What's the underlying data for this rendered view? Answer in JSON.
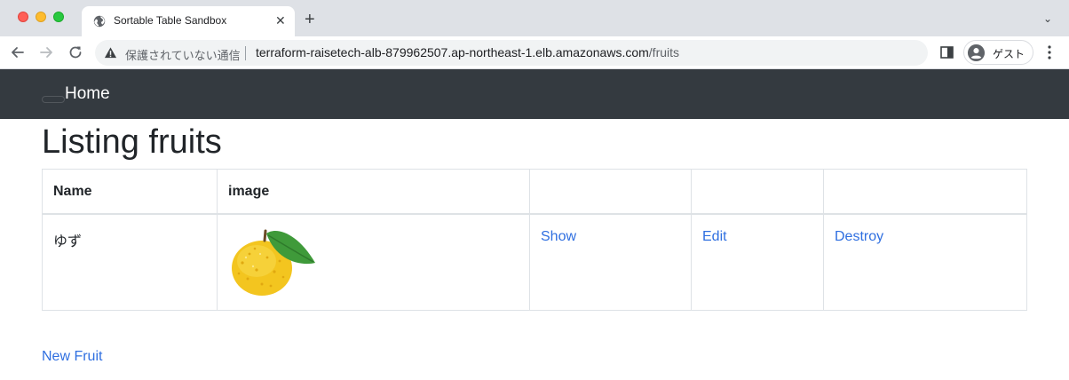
{
  "browser": {
    "tab_title": "Sortable Table Sandbox",
    "close_glyph": "✕",
    "new_tab_glyph": "+",
    "tab_menu_glyph": "⌄",
    "security_label": "保護されていない通信",
    "url_host": "terraform-raisetech-alb-879962507.ap-northeast-1.elb.amazonaws.com",
    "url_path": "/fruits",
    "profile_label": "ゲスト"
  },
  "navbar": {
    "brand": "Home",
    "color": "#343a40"
  },
  "page": {
    "title": "Listing fruits",
    "link_color": "#2f6fe0"
  },
  "table": {
    "headers": [
      "Name",
      "image",
      "",
      "",
      ""
    ],
    "rows": [
      {
        "name": "ゆず",
        "image_icon": "yuzu-fruit-image",
        "show": "Show",
        "edit": "Edit",
        "destroy": "Destroy"
      }
    ]
  },
  "footer": {
    "new_link": "New Fruit"
  }
}
